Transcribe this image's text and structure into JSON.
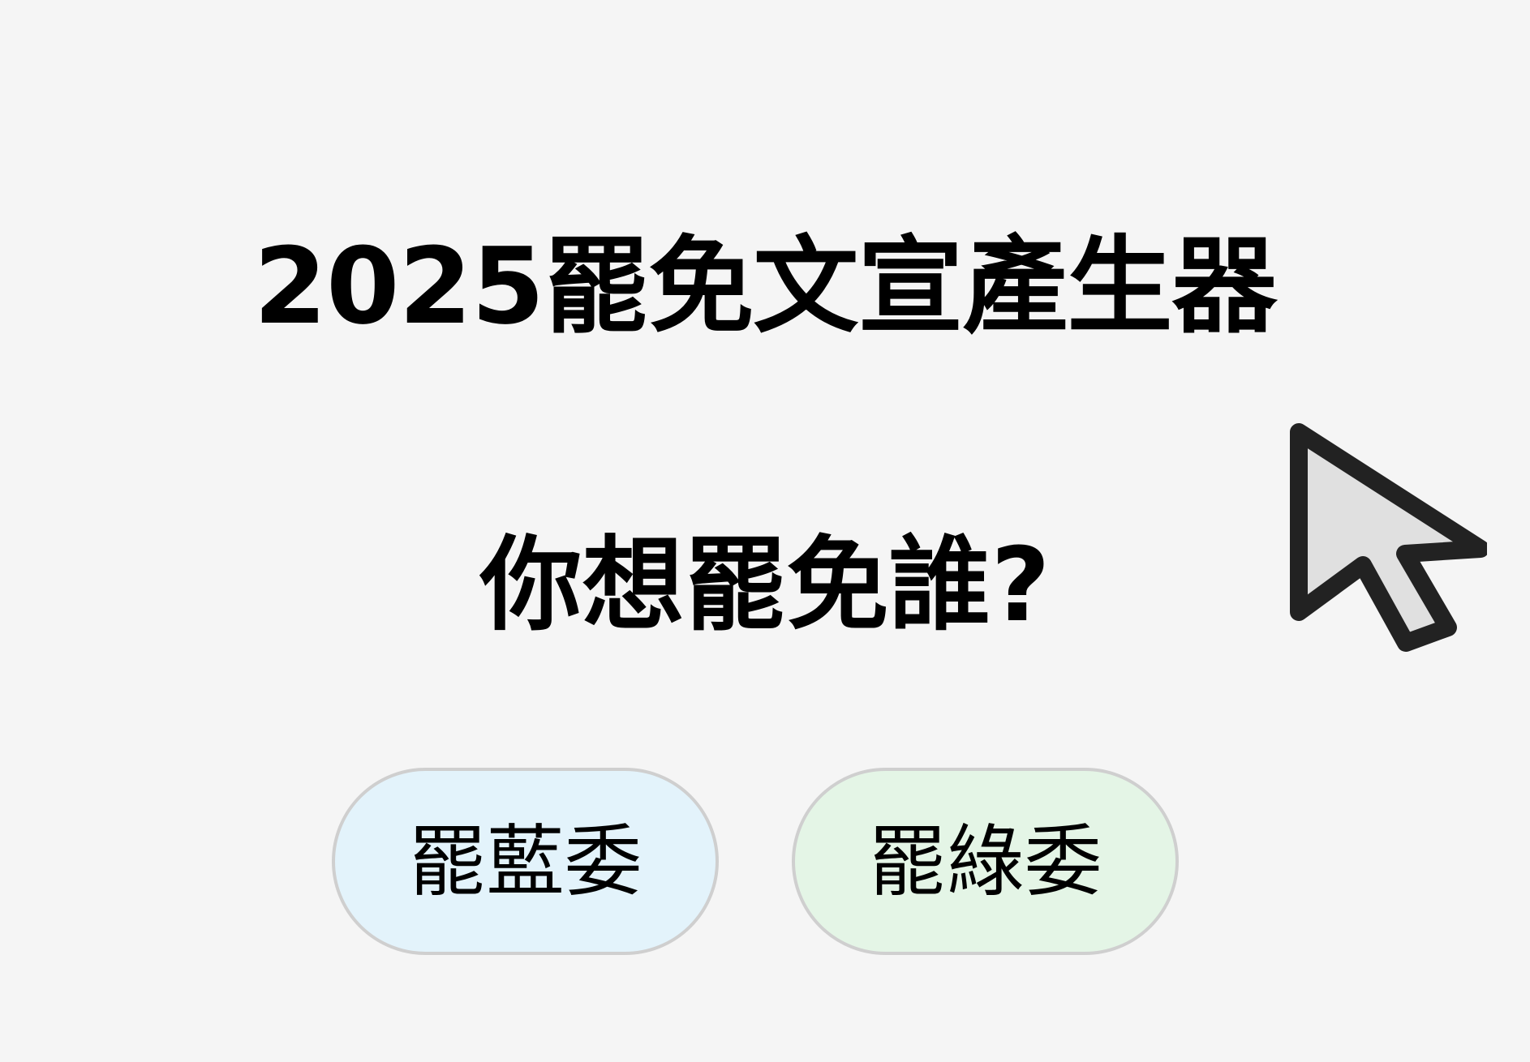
{
  "title": "2025罷免文宣產生器",
  "question": "你想罷免誰?",
  "buttons": {
    "blue": {
      "label": "罷藍委",
      "background": "#e3f3fb"
    },
    "green": {
      "label": "罷綠委",
      "background": "#e4f5e6"
    }
  },
  "colors": {
    "page_background": "#f5f5f5",
    "button_border": "#cfcfcf",
    "cursor_fill": "#e0e0e0",
    "cursor_stroke": "#222222"
  },
  "icons": {
    "cursor": "mouse-pointer-icon"
  }
}
